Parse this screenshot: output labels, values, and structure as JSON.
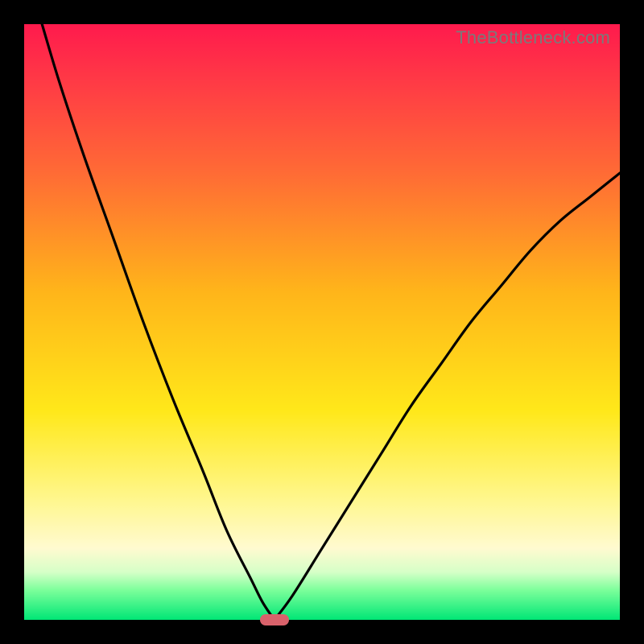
{
  "watermark": "TheBottleneck.com",
  "chart_data": {
    "type": "line",
    "title": "",
    "xlabel": "",
    "ylabel": "",
    "xlim": [
      0,
      100
    ],
    "ylim": [
      0,
      100
    ],
    "grid": false,
    "legend": false,
    "optimum_x": 42,
    "marker": {
      "x": 42,
      "y": 0,
      "color": "#d9626b"
    },
    "series": [
      {
        "name": "left-branch",
        "x": [
          3,
          6,
          10,
          15,
          20,
          25,
          30,
          34,
          38,
          40,
          42
        ],
        "y": [
          100,
          90,
          78,
          64,
          50,
          37,
          25,
          15,
          7,
          3,
          0
        ]
      },
      {
        "name": "right-branch",
        "x": [
          42,
          45,
          50,
          55,
          60,
          65,
          70,
          75,
          80,
          85,
          90,
          95,
          100
        ],
        "y": [
          0,
          4,
          12,
          20,
          28,
          36,
          43,
          50,
          56,
          62,
          67,
          71,
          75
        ]
      }
    ],
    "background_gradient": {
      "top": "#ff1a4d",
      "mid": "#ffe81a",
      "bottom": "#00e676"
    }
  }
}
